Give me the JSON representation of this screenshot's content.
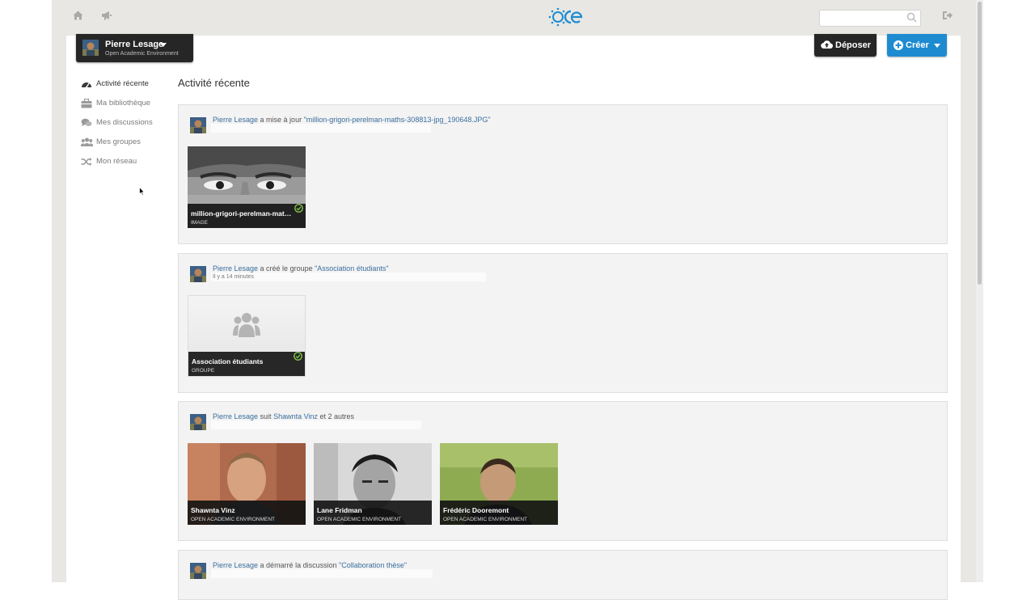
{
  "search": {
    "placeholder": ""
  },
  "user": {
    "name": "Pierre Lesage",
    "tenant": "Open Academic Environment"
  },
  "toolbar": {
    "upload_label": "Déposer",
    "create_label": "Créer"
  },
  "nav": [
    {
      "label": "Activité récente",
      "icon": "dashboard-icon",
      "active": true
    },
    {
      "label": "Ma bibliothèque",
      "icon": "briefcase-icon"
    },
    {
      "label": "Mes discussions",
      "icon": "comments-icon"
    },
    {
      "label": "Mes groupes",
      "icon": "group-icon"
    },
    {
      "label": "Mon réseau",
      "icon": "random-icon"
    }
  ],
  "page_title": "Activité récente",
  "activities": [
    {
      "actor": "Pierre Lesage",
      "verb": " a mise à jour ",
      "object": "\"million-grigori-perelman-maths-308813-jpg_190648.JPG\"",
      "time": "",
      "items": [
        {
          "title": "million-grigori-perelman-maths-308813-jpg_190648.JPG",
          "type": "IMAGE"
        }
      ]
    },
    {
      "actor": "Pierre Lesage",
      "verb": " a créé le groupe ",
      "object": "\"Association étudiants\"",
      "time": "Il y a 14 minutes",
      "items": [
        {
          "title": "Association étudiants",
          "type": "GROUPE"
        }
      ]
    },
    {
      "actor": "Pierre Lesage",
      "verb": " suit ",
      "object": "Shawnta Vinz",
      "suffix": " et 2 autres",
      "time": "",
      "items": [
        {
          "title": "Shawnta Vinz",
          "type": "OPEN ACADEMIC ENVIRONMENT"
        },
        {
          "title": "Lane Fridman",
          "type": "OPEN ACADEMIC ENVIRONMENT"
        },
        {
          "title": "Frédéric Dooremont",
          "type": "OPEN ACADEMIC ENVIRONMENT"
        }
      ]
    },
    {
      "actor": "Pierre Lesage",
      "verb": " a démarré la discussion ",
      "object": "\"Collaboration thèse\"",
      "time": "",
      "items": []
    }
  ],
  "colors": {
    "primary": "#1e8bd1",
    "link": "#3a6f9e",
    "dark_button": "#262626",
    "success": "#7fc34c",
    "logo": "#1e8bd1"
  }
}
